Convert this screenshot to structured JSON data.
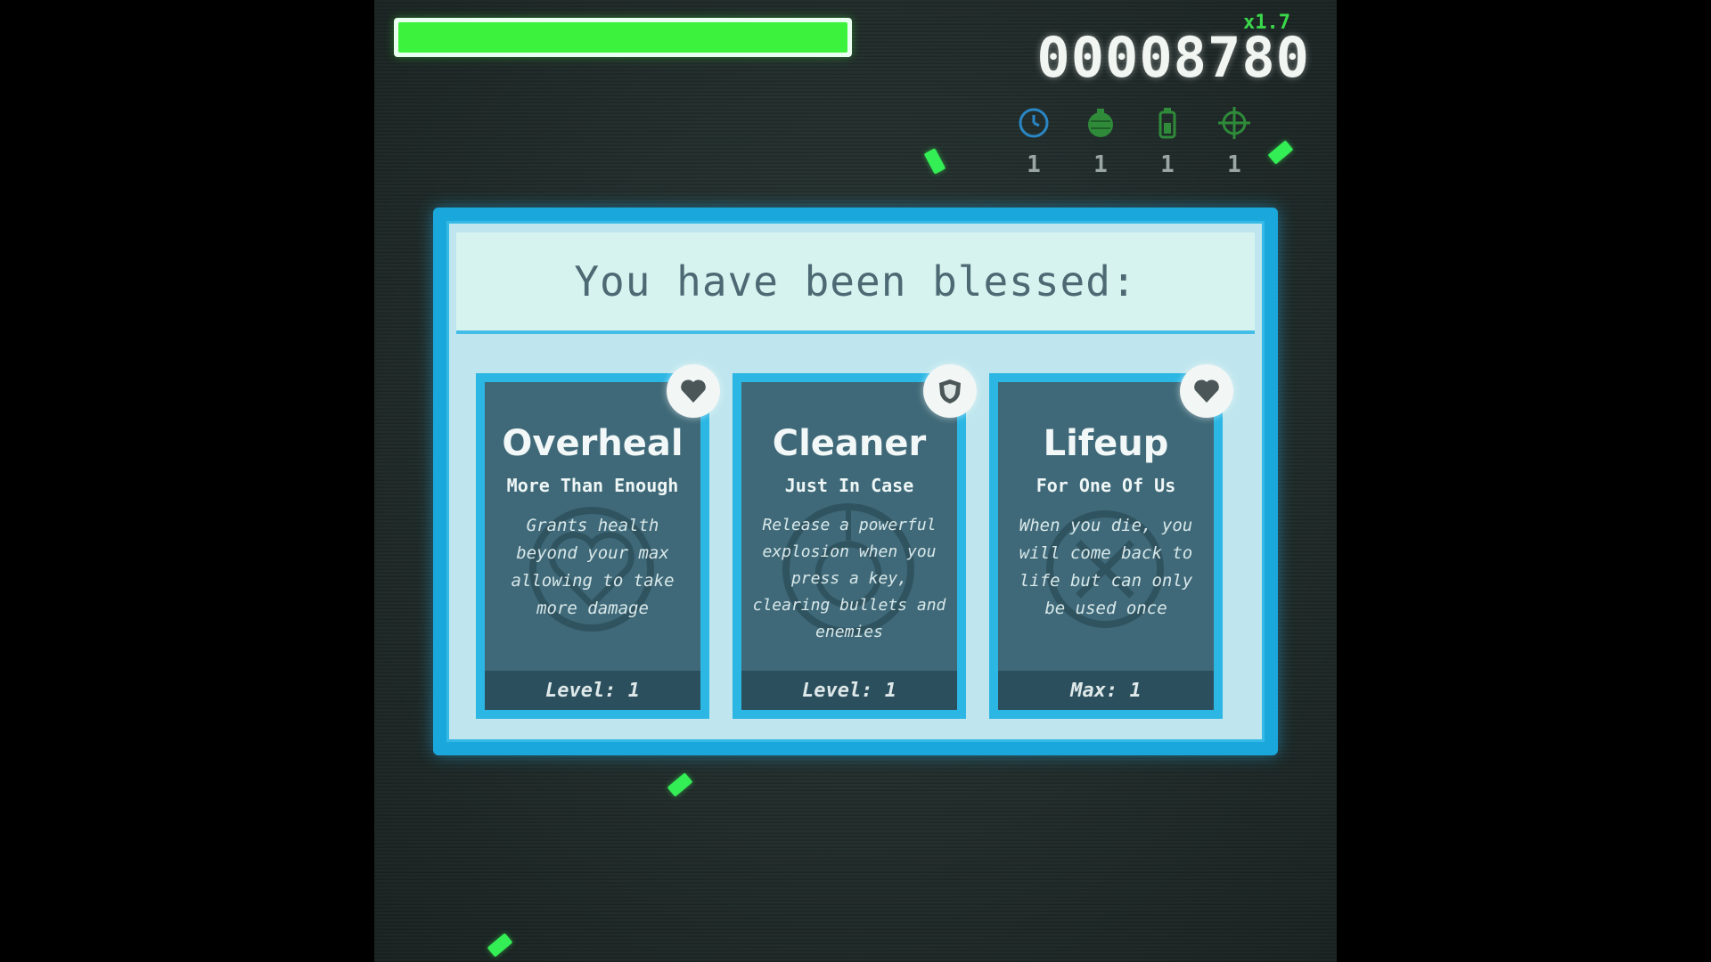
{
  "hud": {
    "health_fraction": 1.0,
    "score": "00008780",
    "multiplier": "x1.7"
  },
  "powerups": [
    {
      "icon": "clock-icon",
      "count": "1",
      "color": "#2a7fb8"
    },
    {
      "icon": "grenade-icon",
      "count": "1",
      "color": "#2f8a3a"
    },
    {
      "icon": "battery-icon",
      "count": "1",
      "color": "#2f8a3a"
    },
    {
      "icon": "crosshair-icon",
      "count": "1",
      "color": "#2f8a3a"
    }
  ],
  "dialog": {
    "title": "You have been blessed:"
  },
  "cards": [
    {
      "name": "Overheal",
      "subtitle": "More Than Enough",
      "description": "Grants health beyond your max allowing to take more damage",
      "level": "Level: 1",
      "badge_icon": "heart-icon"
    },
    {
      "name": "Cleaner",
      "subtitle": "Just In Case",
      "description": "Release a powerful explosion when you press a key, clearing bullets and enemies",
      "level": "Level: 1",
      "badge_icon": "shield-icon"
    },
    {
      "name": "Lifeup",
      "subtitle": "For One Of Us",
      "description": "When you die, you will come back to life but can only be used once",
      "level": "Max: 1",
      "badge_icon": "heart-icon"
    }
  ],
  "colors": {
    "accent": "#1aa8dc",
    "health": "#3df23d",
    "pickup": "#33ee55"
  }
}
